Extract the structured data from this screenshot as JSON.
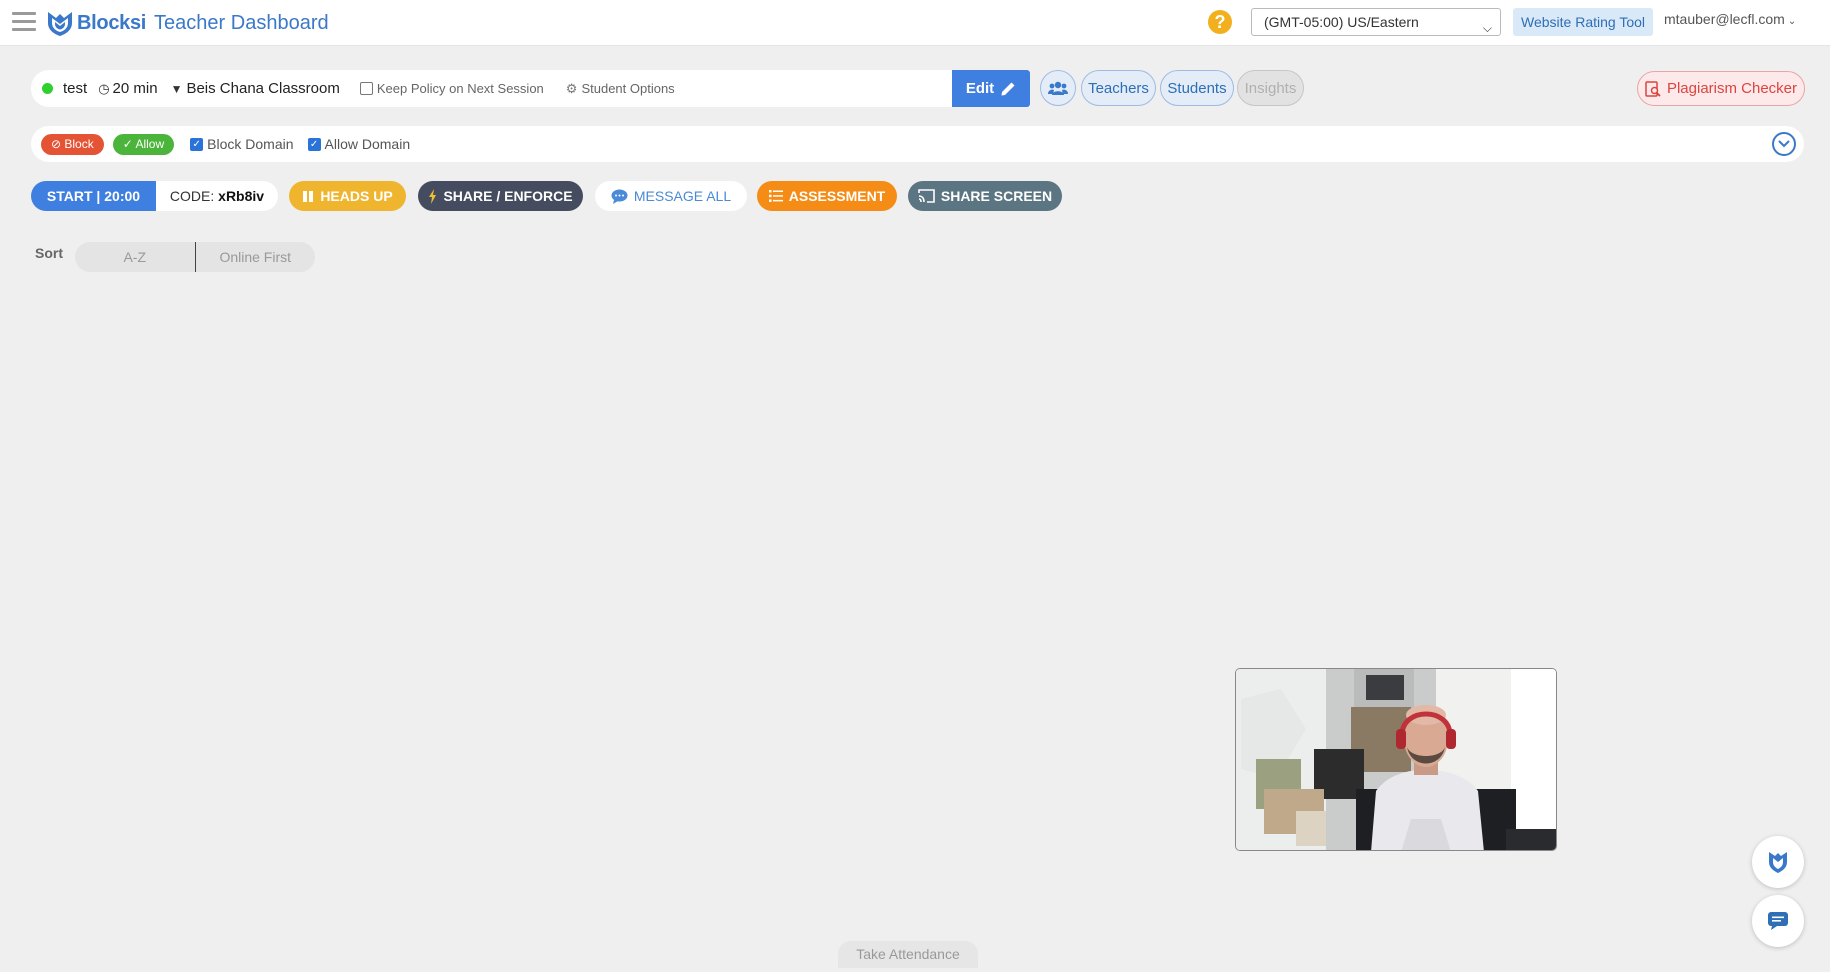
{
  "header": {
    "brand": "Blocksi",
    "title": "Teacher Dashboard",
    "help_icon": "question-circle-icon",
    "timezone": "(GMT-05:00) US/Eastern",
    "rating_tool": "Website Rating Tool",
    "user_email": "mtauber@lecfl.com"
  },
  "session": {
    "status_color": "#2fd02f",
    "name": "test",
    "duration": "20 min",
    "classroom": "Beis Chana Classroom",
    "keep_policy_label": "Keep Policy on Next Session",
    "keep_policy_checked": false,
    "student_options_label": "Student Options",
    "edit_label": "Edit"
  },
  "user_tabs": {
    "teachers": "Teachers",
    "students": "Students",
    "insights": "Insights"
  },
  "plagiarism": {
    "label": "Plagiarism Checker"
  },
  "domains": {
    "block_tag": "Block",
    "allow_tag": "Allow",
    "block_domain_label": "Block Domain",
    "block_domain_checked": true,
    "allow_domain_label": "Allow Domain",
    "allow_domain_checked": true
  },
  "actions": {
    "start_label": "START | 20:00",
    "code_label": "CODE:",
    "code_value": "xRb8iv",
    "heads_up": "HEADS UP",
    "share_enforce": "SHARE / ENFORCE",
    "message_all": "MESSAGE ALL",
    "assessment": "ASSESSMENT",
    "share_screen": "SHARE SCREEN"
  },
  "sort": {
    "label": "Sort",
    "options": [
      "A-Z",
      "Online First"
    ]
  },
  "footer": {
    "take_attendance": "Take Attendance"
  },
  "colors": {
    "accent": "#3f7fe0",
    "brand_blue": "#3a78c9",
    "heads_up": "#f0b52e",
    "assessment": "#f58c16",
    "share": "#454c5f",
    "block": "#e55335",
    "allow": "#4bb43a",
    "plagiarism": "#d9463f"
  }
}
